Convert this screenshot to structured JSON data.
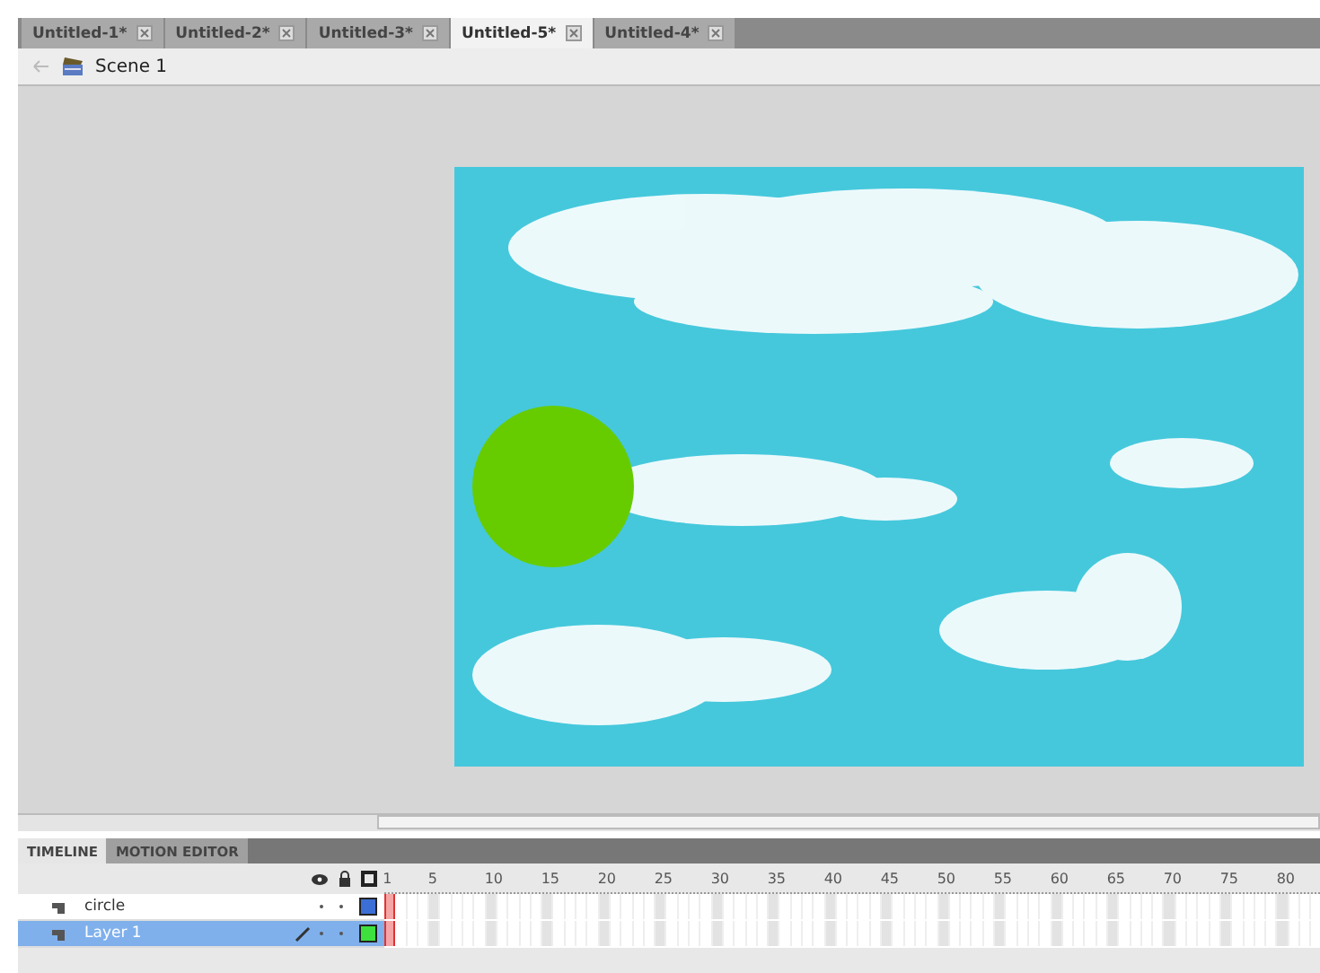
{
  "document_tabs": [
    {
      "label": "Untitled-1*",
      "selected": false
    },
    {
      "label": "Untitled-2*",
      "selected": false
    },
    {
      "label": "Untitled-3*",
      "selected": false
    },
    {
      "label": "Untitled-5*",
      "selected": true
    },
    {
      "label": "Untitled-4*",
      "selected": false
    }
  ],
  "scene": {
    "label": "Scene 1"
  },
  "panel_tabs": [
    {
      "label": "TIMELINE",
      "selected": true
    },
    {
      "label": "MOTION EDITOR",
      "selected": false
    }
  ],
  "frame_numbers": [
    "1",
    "5",
    "10",
    "15",
    "20",
    "25",
    "30",
    "35",
    "40",
    "45",
    "50",
    "55",
    "60",
    "65",
    "70",
    "75",
    "80"
  ],
  "layers": [
    {
      "name": "circle",
      "selected": false,
      "color": "#3b6fd6"
    },
    {
      "name": "Layer 1",
      "selected": true,
      "color": "#3ee03e"
    }
  ]
}
